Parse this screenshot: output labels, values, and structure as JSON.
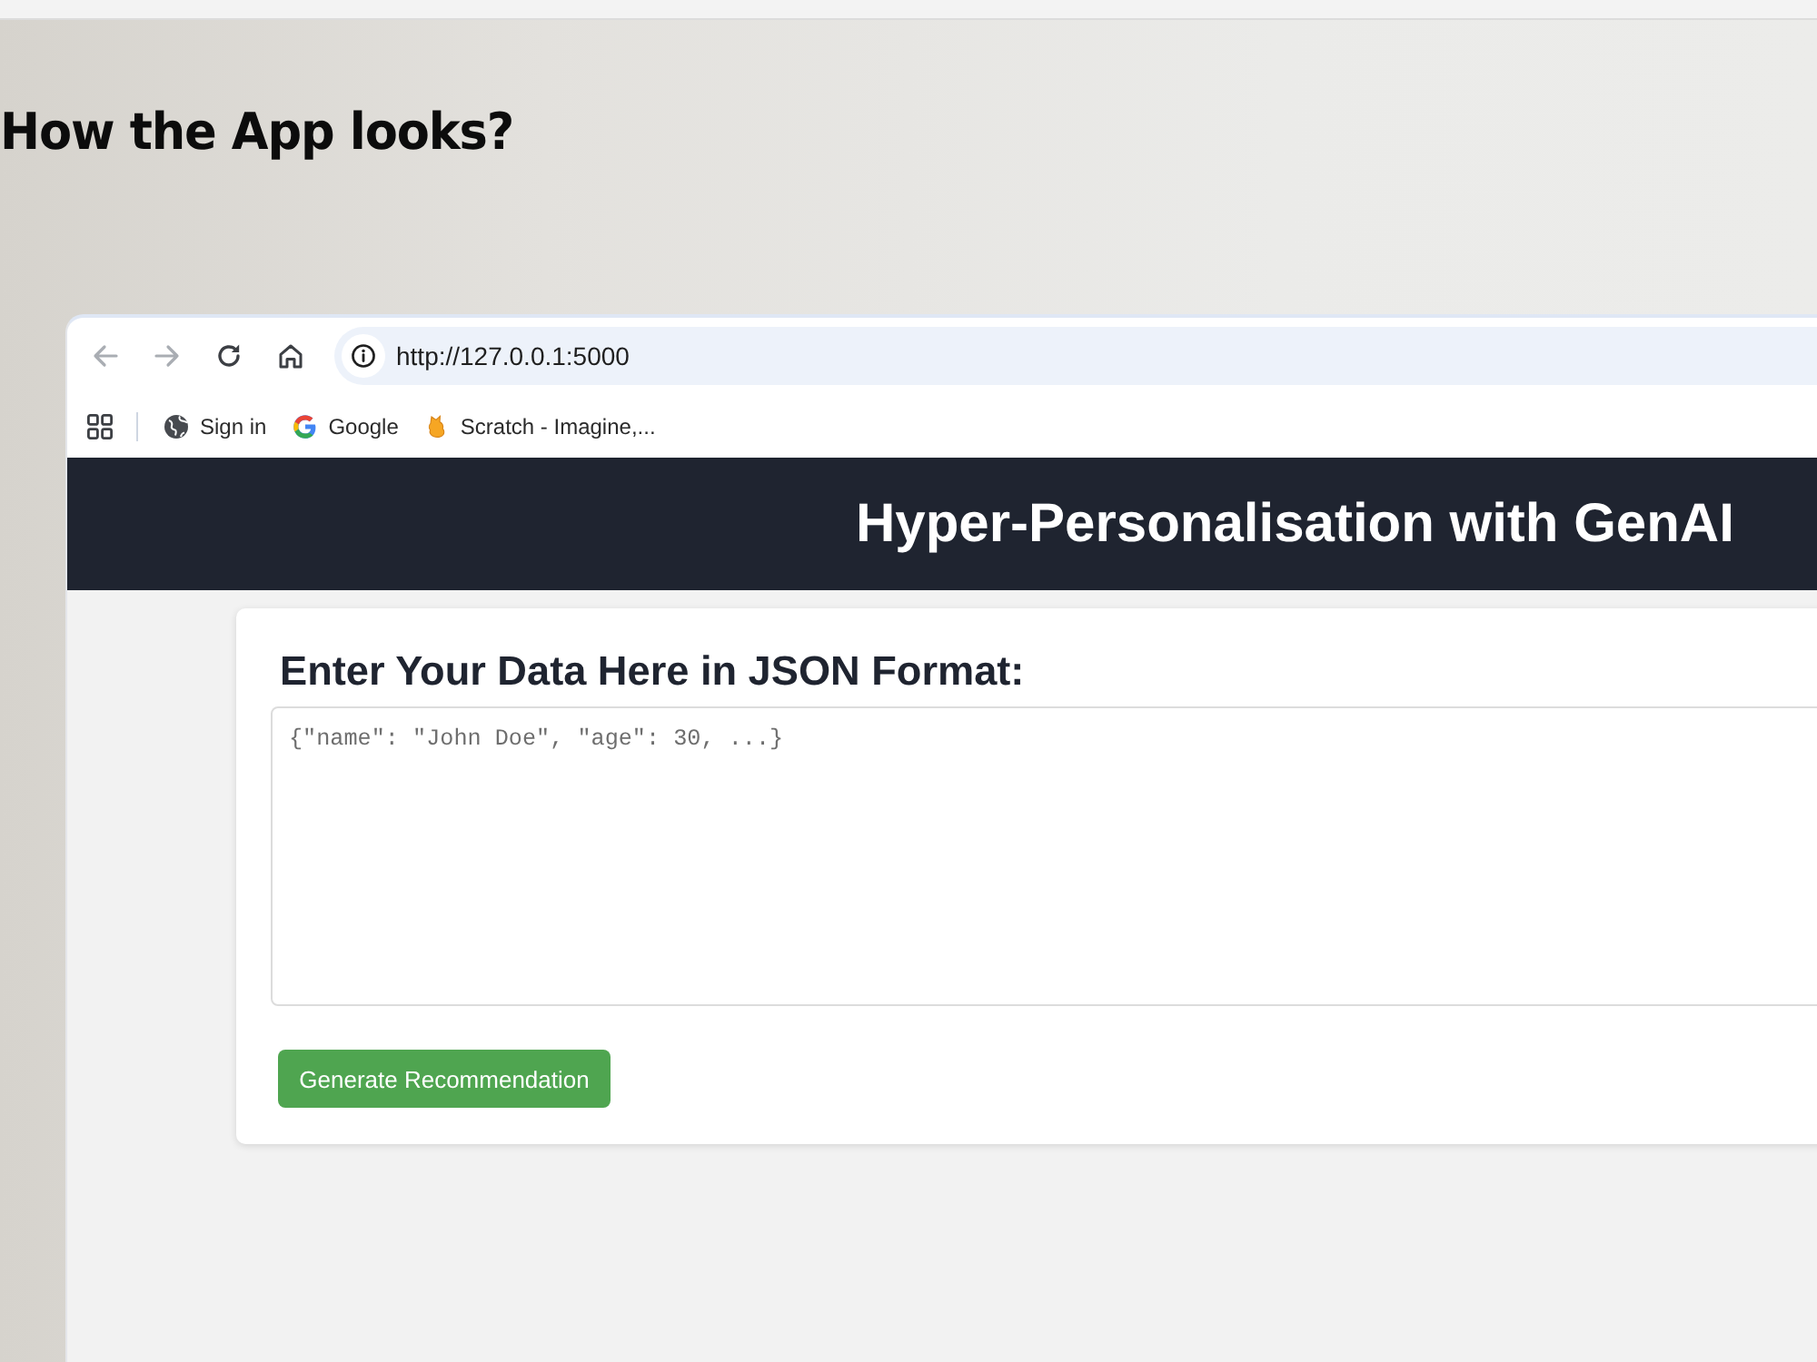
{
  "slide": {
    "title": "How the App looks?"
  },
  "browser": {
    "back": {
      "disabled": true
    },
    "forward": {
      "disabled": true
    },
    "address": "http://127.0.0.1:5000",
    "bookmarks": [
      {
        "kind": "globe",
        "label": "Sign in"
      },
      {
        "kind": "letter-g",
        "label": "Google"
      },
      {
        "kind": "favicon",
        "label": "Scratch - Imagine,..."
      }
    ]
  },
  "app": {
    "header": {
      "title": "Hyper-Personalisation with GenAI"
    },
    "form": {
      "heading": "Enter Your Data Here in JSON Format:",
      "input": {
        "placeholder": "{\"name\": \"John Doe\", \"age\": 30, ...}"
      },
      "button": "Generate Recommendation"
    }
  }
}
